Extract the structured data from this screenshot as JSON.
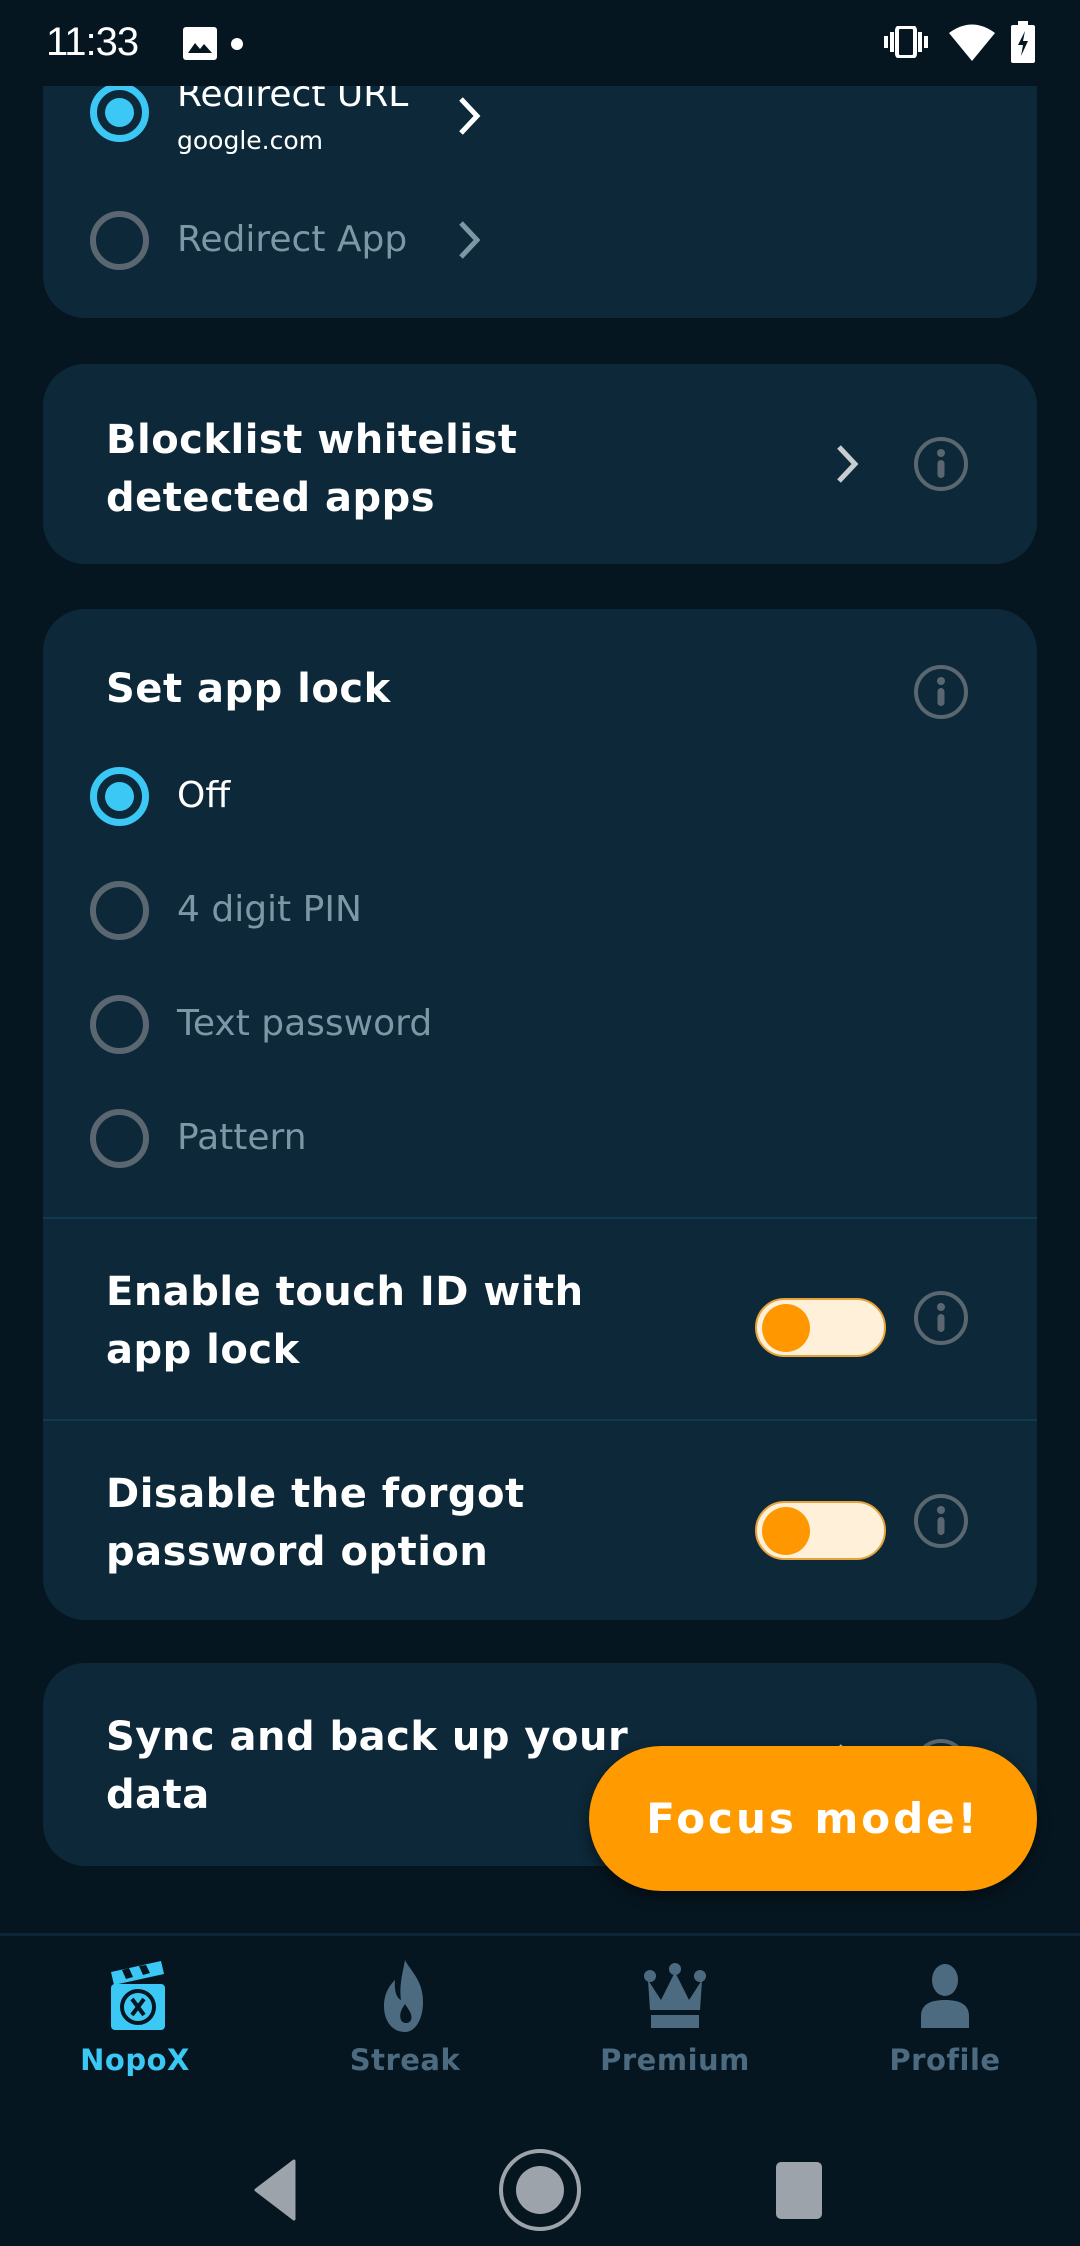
{
  "status_bar": {
    "time": "11:33",
    "icons": [
      "image-notification-icon",
      "notification-dot",
      "vibrate-icon",
      "wifi-icon",
      "battery-charging-icon"
    ]
  },
  "redirect_card": {
    "options": [
      {
        "label": "Redirect URL",
        "sublabel": "google.com",
        "selected": true
      },
      {
        "label": "Redirect App",
        "selected": false
      }
    ]
  },
  "blocklist_card": {
    "title_line1": "Blocklist whitelist",
    "title_line2": "detected apps"
  },
  "app_lock_card": {
    "title": "Set app lock",
    "options": [
      {
        "label": "Off",
        "selected": true
      },
      {
        "label": "4 digit PIN",
        "selected": false
      },
      {
        "label": "Text password",
        "selected": false
      },
      {
        "label": "Pattern",
        "selected": false
      }
    ],
    "touch_id": {
      "line1": "Enable touch ID with",
      "line2": "app lock",
      "enabled": false
    },
    "forgot_password": {
      "line1": "Disable the forgot",
      "line2": "password option",
      "enabled": false
    }
  },
  "sync_card": {
    "line1": "Sync and back up your",
    "line2": "data"
  },
  "focus_button": {
    "label": "Focus mode!"
  },
  "bottom_nav": {
    "items": [
      {
        "label": "NopoX",
        "icon": "clapperboard-x-icon",
        "active": true
      },
      {
        "label": "Streak",
        "icon": "flame-icon",
        "active": false
      },
      {
        "label": "Premium",
        "icon": "crown-icon",
        "active": false
      },
      {
        "label": "Profile",
        "icon": "person-icon",
        "active": false
      }
    ]
  },
  "colors": {
    "background": "#061620",
    "card": "#0D2838",
    "accent": "#3CC8F5",
    "focus_button": "#FF9B00",
    "toggle_thumb": "#FF9800",
    "toggle_track": "#FFF0DA",
    "inactive_nav": "#4D6B80"
  }
}
